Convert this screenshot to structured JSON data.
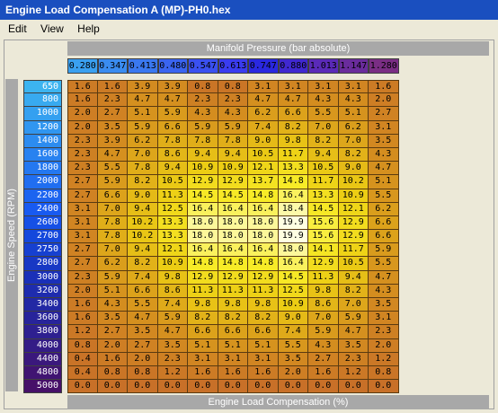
{
  "window": {
    "title": "Engine Load Compensation A (MP)-PH0.hex"
  },
  "menu": [
    "Edit",
    "View",
    "Help"
  ],
  "table": {
    "x_axis_title": "Manifold Pressure (bar absolute)",
    "y_axis_title": "Engine Speed (RPM)",
    "value_title": "Engine Load Compensation (%)",
    "x_values": [
      "0.280",
      "0.347",
      "0.413",
      "0.480",
      "0.547",
      "0.613",
      "0.747",
      "0.880",
      "1.013",
      "1.147",
      "1.280"
    ],
    "x_colors": [
      "#3aa0f0",
      "#3a8cf0",
      "#3a78f0",
      "#3a64f0",
      "#3a50f0",
      "#3a3cf0",
      "#2a28e0",
      "#4028d0",
      "#5a2ab8",
      "#6a2c9c",
      "#7a2e84"
    ],
    "y_values": [
      "650",
      "800",
      "1000",
      "1200",
      "1400",
      "1600",
      "1800",
      "2000",
      "2200",
      "2400",
      "2600",
      "2700",
      "2750",
      "2800",
      "3000",
      "3200",
      "3400",
      "3600",
      "3800",
      "4000",
      "4400",
      "4800",
      "5000"
    ],
    "y_colors": [
      "#3cb4f0",
      "#38aaf0",
      "#34a0f0",
      "#3096f0",
      "#2c8cf0",
      "#2882f0",
      "#2478f0",
      "#206ef0",
      "#1c64f0",
      "#185af0",
      "#1650e6",
      "#1448dc",
      "#1640d0",
      "#1838c4",
      "#1a30b8",
      "#1e2cae",
      "#2228a4",
      "#28249a",
      "#2e2090",
      "#341c86",
      "#3a187c",
      "#401472",
      "#461068"
    ],
    "rows": [
      [
        "1.6",
        "1.6",
        "3.9",
        "3.9",
        "0.8",
        "0.8",
        "3.1",
        "3.1",
        "3.1",
        "3.1",
        "1.6"
      ],
      [
        "1.6",
        "2.3",
        "4.7",
        "4.7",
        "2.3",
        "2.3",
        "4.7",
        "4.7",
        "4.3",
        "4.3",
        "2.0"
      ],
      [
        "2.0",
        "2.7",
        "5.1",
        "5.9",
        "4.3",
        "4.3",
        "6.2",
        "6.6",
        "5.5",
        "5.1",
        "2.7"
      ],
      [
        "2.0",
        "3.5",
        "5.9",
        "6.6",
        "5.9",
        "5.9",
        "7.4",
        "8.2",
        "7.0",
        "6.2",
        "3.1"
      ],
      [
        "2.3",
        "3.9",
        "6.2",
        "7.8",
        "7.8",
        "7.8",
        "9.0",
        "9.8",
        "8.2",
        "7.0",
        "3.5"
      ],
      [
        "2.3",
        "4.7",
        "7.0",
        "8.6",
        "9.4",
        "9.4",
        "10.5",
        "11.7",
        "9.4",
        "8.2",
        "4.3"
      ],
      [
        "2.3",
        "5.5",
        "7.8",
        "9.4",
        "10.9",
        "10.9",
        "12.1",
        "13.3",
        "10.5",
        "9.0",
        "4.7"
      ],
      [
        "2.7",
        "5.9",
        "8.2",
        "10.5",
        "12.9",
        "12.9",
        "13.7",
        "14.8",
        "11.7",
        "10.2",
        "5.1"
      ],
      [
        "2.7",
        "6.6",
        "9.0",
        "11.3",
        "14.5",
        "14.5",
        "14.8",
        "16.4",
        "13.3",
        "10.9",
        "5.5"
      ],
      [
        "3.1",
        "7.0",
        "9.4",
        "12.5",
        "16.4",
        "16.4",
        "16.4",
        "18.4",
        "14.5",
        "12.1",
        "6.2"
      ],
      [
        "3.1",
        "7.8",
        "10.2",
        "13.3",
        "18.0",
        "18.0",
        "18.0",
        "19.9",
        "15.6",
        "12.9",
        "6.6"
      ],
      [
        "3.1",
        "7.8",
        "10.2",
        "13.3",
        "18.0",
        "18.0",
        "18.0",
        "19.9",
        "15.6",
        "12.9",
        "6.6"
      ],
      [
        "2.7",
        "7.0",
        "9.4",
        "12.1",
        "16.4",
        "16.4",
        "16.4",
        "18.0",
        "14.1",
        "11.7",
        "5.9"
      ],
      [
        "2.7",
        "6.2",
        "8.2",
        "10.9",
        "14.8",
        "14.8",
        "14.8",
        "16.4",
        "12.9",
        "10.5",
        "5.5"
      ],
      [
        "2.3",
        "5.9",
        "7.4",
        "9.8",
        "12.9",
        "12.9",
        "12.9",
        "14.5",
        "11.3",
        "9.4",
        "4.7"
      ],
      [
        "2.0",
        "5.1",
        "6.6",
        "8.6",
        "11.3",
        "11.3",
        "11.3",
        "12.5",
        "9.8",
        "8.2",
        "4.3"
      ],
      [
        "1.6",
        "4.3",
        "5.5",
        "7.4",
        "9.8",
        "9.8",
        "9.8",
        "10.9",
        "8.6",
        "7.0",
        "3.5"
      ],
      [
        "1.6",
        "3.5",
        "4.7",
        "5.9",
        "8.2",
        "8.2",
        "8.2",
        "9.0",
        "7.0",
        "5.9",
        "3.1"
      ],
      [
        "1.2",
        "2.7",
        "3.5",
        "4.7",
        "6.6",
        "6.6",
        "6.6",
        "7.4",
        "5.9",
        "4.7",
        "2.3"
      ],
      [
        "0.8",
        "2.0",
        "2.7",
        "3.5",
        "5.1",
        "5.1",
        "5.1",
        "5.5",
        "4.3",
        "3.5",
        "2.0"
      ],
      [
        "0.4",
        "1.6",
        "2.0",
        "2.3",
        "3.1",
        "3.1",
        "3.1",
        "3.5",
        "2.7",
        "2.3",
        "1.2"
      ],
      [
        "0.4",
        "0.8",
        "0.8",
        "1.2",
        "1.6",
        "1.6",
        "1.6",
        "2.0",
        "1.6",
        "1.2",
        "0.8"
      ],
      [
        "0.0",
        "0.0",
        "0.0",
        "0.0",
        "0.0",
        "0.0",
        "0.0",
        "0.0",
        "0.0",
        "0.0",
        "0.0"
      ]
    ]
  }
}
